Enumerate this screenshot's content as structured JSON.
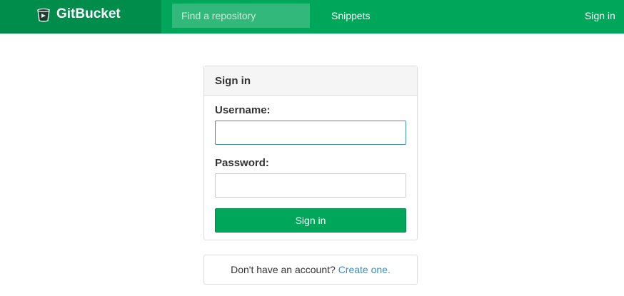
{
  "header": {
    "brand": "GitBucket",
    "search_placeholder": "Find a repository",
    "snippets_label": "Snippets",
    "signin_label": "Sign in"
  },
  "login": {
    "title": "Sign in",
    "username_label": "Username:",
    "username_value": "",
    "password_label": "Password:",
    "password_value": "",
    "submit_label": "Sign in"
  },
  "signup": {
    "prompt": "Don't have an account?",
    "link_label": "Create one."
  },
  "colors": {
    "navbar": "#00a65a",
    "brand_bg": "#008d4c",
    "link": "#3c8dbc"
  },
  "icons": {
    "brand": "gitbucket-logo-icon"
  }
}
